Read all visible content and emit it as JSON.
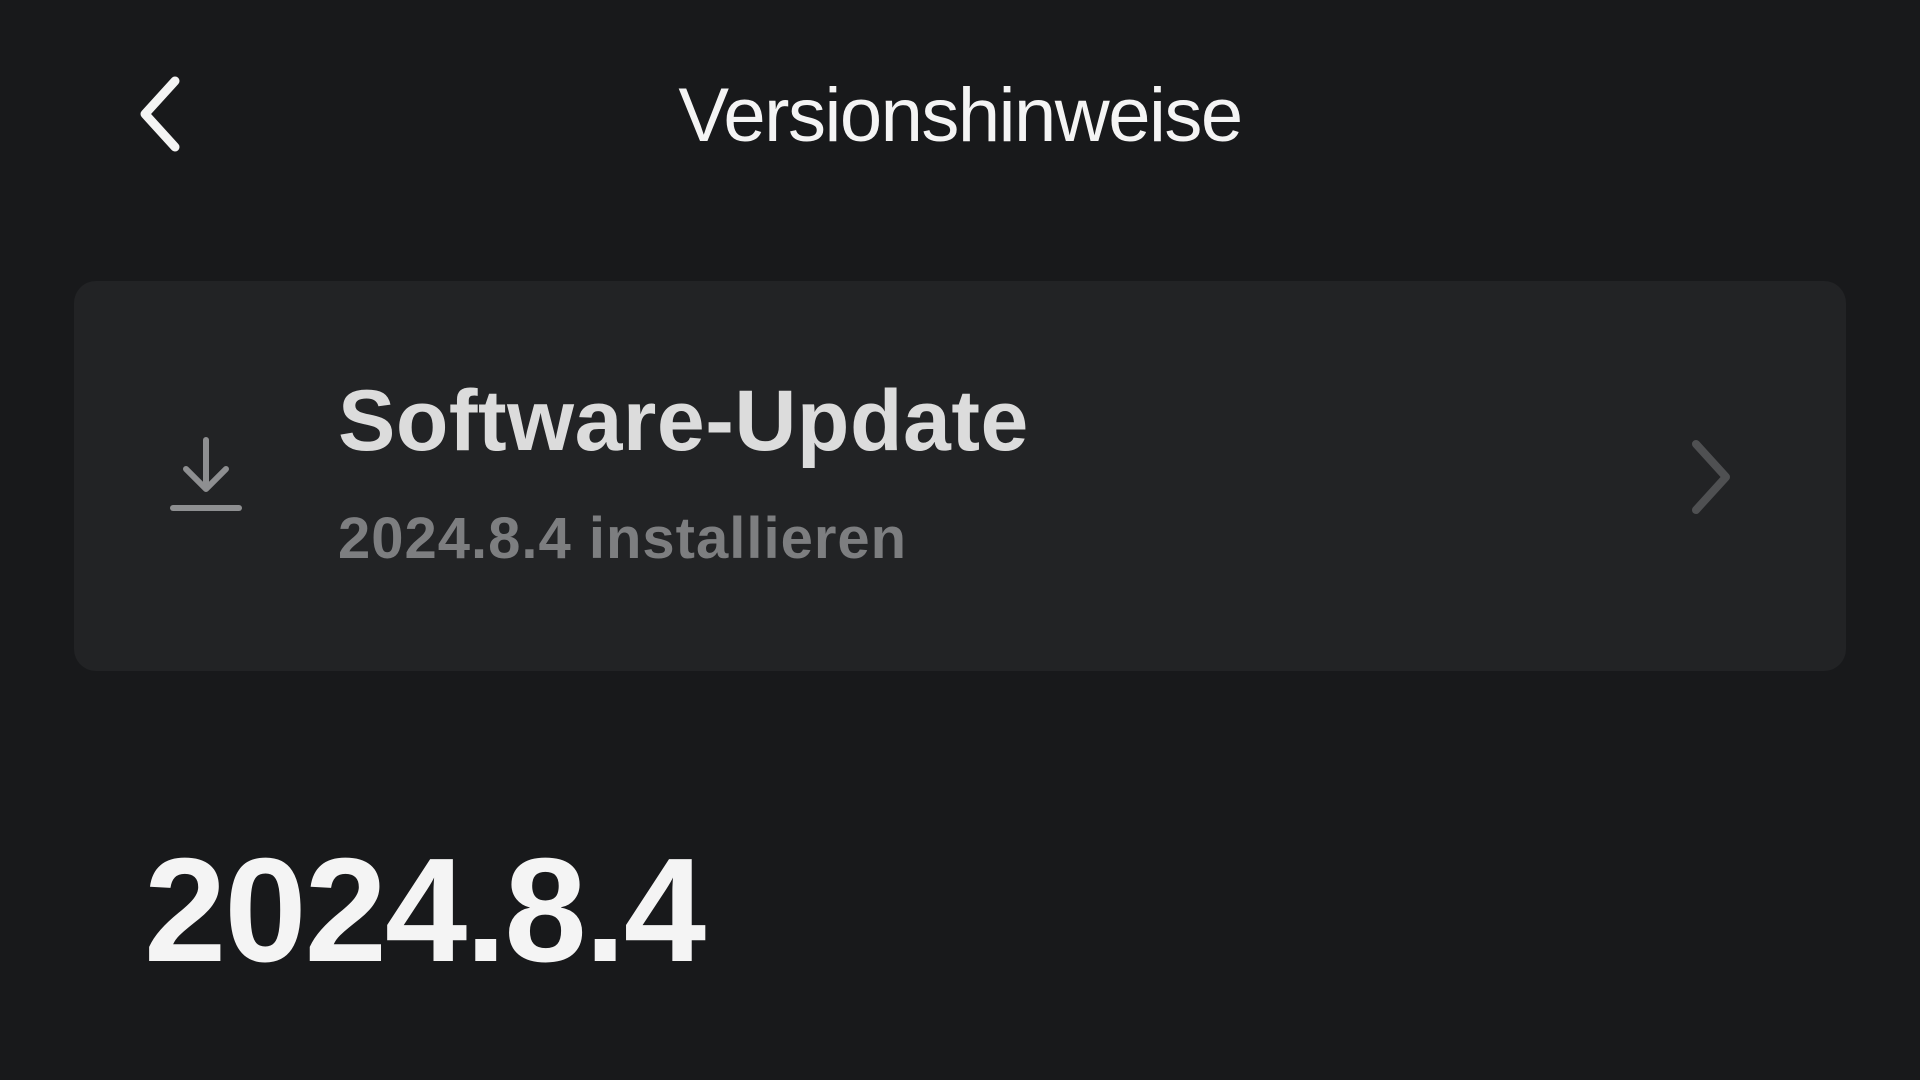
{
  "header": {
    "title": "Versionshinweise",
    "back_icon": "chevron-left-icon"
  },
  "update_card": {
    "icon": "download-icon",
    "title": "Software-Update",
    "subtitle": "2024.8.4 installieren",
    "chevron_icon": "chevron-right-icon"
  },
  "release": {
    "version": "2024.8.4"
  },
  "colors": {
    "background": "#18191b",
    "card": "#222325",
    "title_text": "#f4f4f4",
    "card_title_text": "#dcdcdc",
    "muted_text": "#7d7e80"
  }
}
